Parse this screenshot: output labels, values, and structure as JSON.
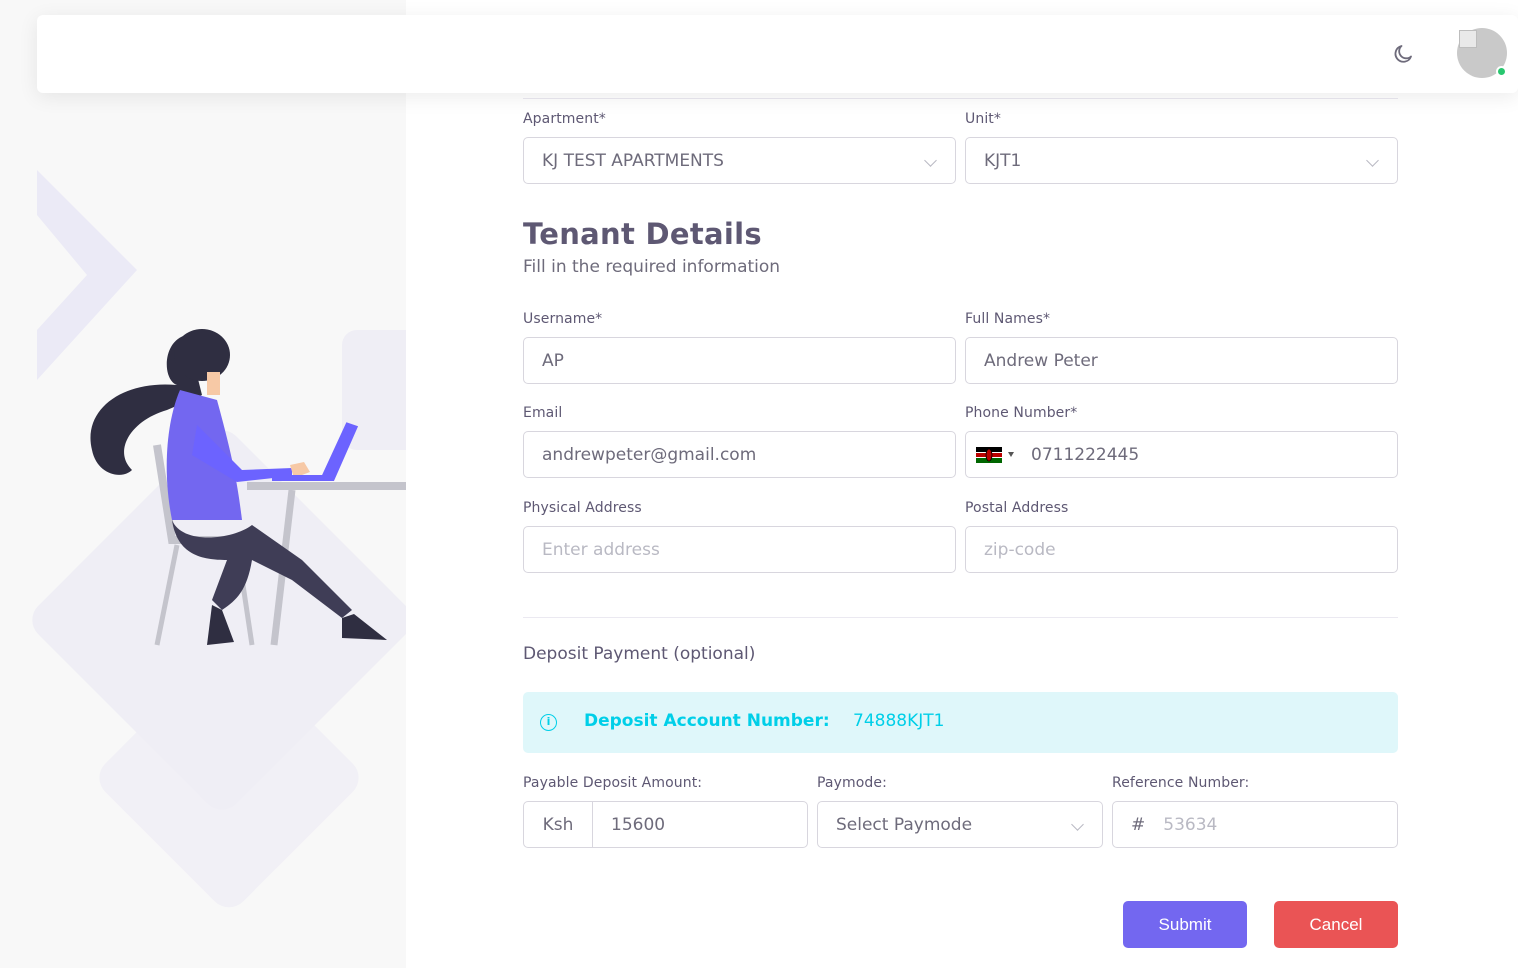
{
  "navbar": {
    "theme_toggle_icon": "moon-icon",
    "avatar_icon": "user-avatar",
    "status_color": "#28c76f"
  },
  "form": {
    "apartment": {
      "label": "Apartment*",
      "value": "KJ TEST APARTMENTS"
    },
    "unit": {
      "label": "Unit*",
      "value": "KJT1"
    },
    "section_title": "Tenant Details",
    "section_subtitle": "Fill in the required information",
    "username": {
      "label": "Username*",
      "value": "AP"
    },
    "full_names": {
      "label": "Full Names*",
      "value": "Andrew Peter"
    },
    "email": {
      "label": "Email",
      "value": "andrewpeter@gmail.com"
    },
    "phone": {
      "label": "Phone Number*",
      "value": "0711222445",
      "flag": "kenya-flag-icon"
    },
    "physical_address": {
      "label": "Physical Address",
      "placeholder": "Enter address"
    },
    "postal_address": {
      "label": "Postal Address",
      "placeholder": "zip-code"
    }
  },
  "deposit": {
    "title": "Deposit Payment (optional)",
    "alert_label": "Deposit Account Number:",
    "alert_value": "74888KJT1",
    "amount": {
      "label": "Payable Deposit Amount:",
      "prefix": "Ksh",
      "value": "15600"
    },
    "paymode": {
      "label": "Paymode:",
      "value": "Select Paymode"
    },
    "reference": {
      "label": "Reference Number:",
      "prefix": "#",
      "placeholder": "53634"
    }
  },
  "actions": {
    "submit": "Submit",
    "cancel": "Cancel"
  },
  "colors": {
    "primary": "#7367f0",
    "danger": "#ea5455",
    "info": "#00cfe8"
  }
}
